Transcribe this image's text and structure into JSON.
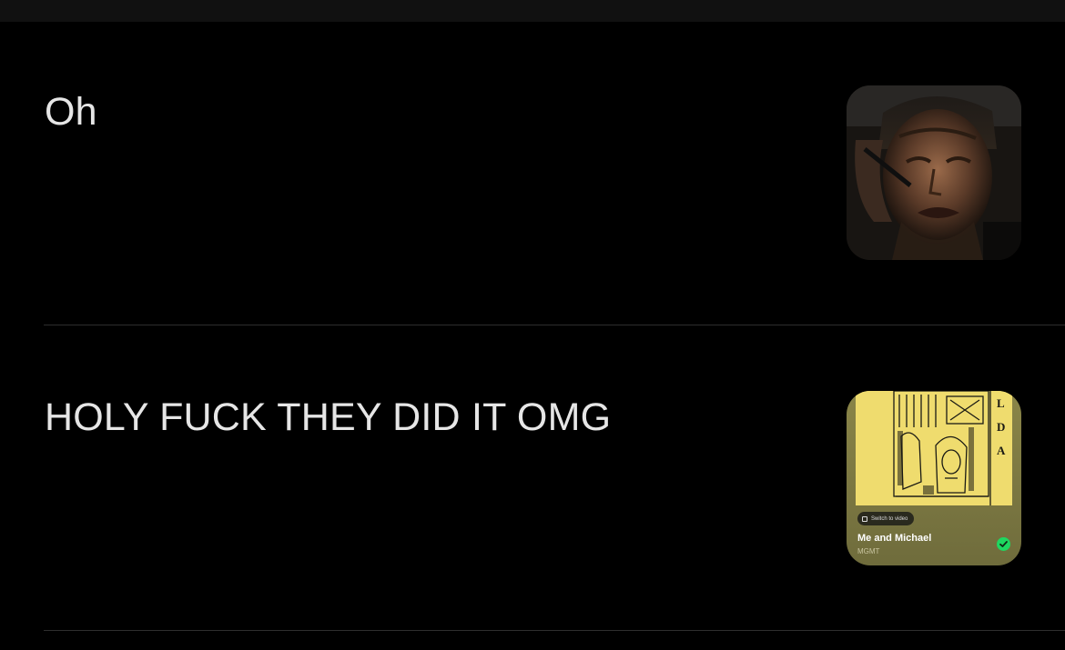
{
  "posts": [
    {
      "text": "Oh",
      "media": {
        "type": "image",
        "icon": "movie-still-thumbnail"
      }
    },
    {
      "text": "HOLY FUCK THEY DID IT OMG",
      "media": {
        "type": "music-card",
        "switch_label": "Switch to video",
        "song_title": "Me and Michael",
        "artist": "MGMT",
        "cover_letters": [
          "L",
          "D",
          "A"
        ],
        "saved_icon": "check-circle-icon",
        "accent_color": "#1ed760",
        "card_color": "#7d7943",
        "cover_color": "#efdc6e"
      }
    }
  ]
}
